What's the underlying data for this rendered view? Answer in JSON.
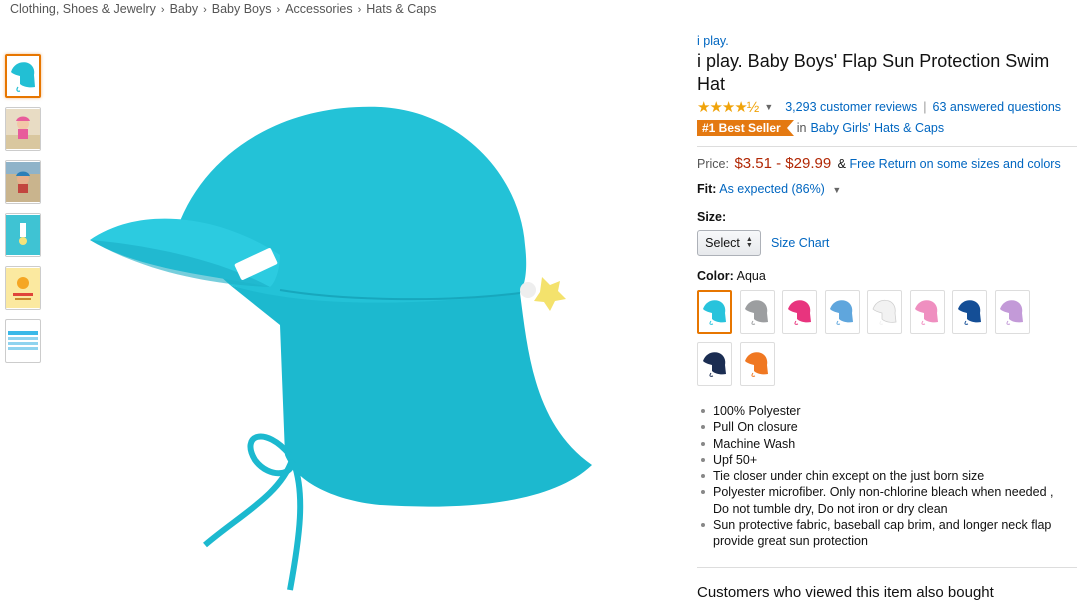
{
  "breadcrumb": [
    "Clothing, Shoes & Jewelry",
    "Baby",
    "Baby Boys",
    "Accessories",
    "Hats & Caps"
  ],
  "product": {
    "brand": "i play.",
    "title": "i play. Baby Boys' Flap Sun Protection Swim Hat",
    "rating": 4.5,
    "stars_text": "★★★★½",
    "reviews": "3,293 customer reviews",
    "questions": "63 answered questions",
    "best_seller_badge": "#1 Best Seller",
    "best_seller_in": "in",
    "best_seller_category": "Baby Girls' Hats & Caps",
    "price_label": "Price:",
    "price": "$3.51 - $29.99",
    "price_amp": "&",
    "free_return": "Free Return on some sizes and colors",
    "fit_label": "Fit:",
    "fit_value": "As expected (86%)",
    "size_label": "Size:",
    "size_select": "Select",
    "size_chart": "Size Chart",
    "color_label": "Color:",
    "color_value": "Aqua",
    "swatch_colors": [
      "#28c3dc",
      "#9c9ea0",
      "#e8347e",
      "#5fa6dd",
      "#f2f2f2",
      "#ef8fc0",
      "#144e96",
      "#c39ad8",
      "#1b2d52",
      "#f07822"
    ],
    "bullets": [
      "100% Polyester",
      "Pull On closure",
      "Machine Wash",
      "Upf 50+",
      "Tie closer under chin except on the just born size",
      "Polyester microfiber. Only non-chlorine bleach when needed , Do not tumble dry, Do not iron or dry clean",
      "Sun protective fabric, baseball cap brim, and longer neck flap provide great sun protection"
    ],
    "also_bought": "Customers who viewed this item also bought"
  },
  "colors": {
    "accent": "#e77600",
    "link": "#0066c0",
    "price": "#b12704",
    "hat": "#22bfd4"
  },
  "icons": {
    "rating_caret": "caret-down-icon",
    "fit_caret": "caret-down-icon"
  }
}
